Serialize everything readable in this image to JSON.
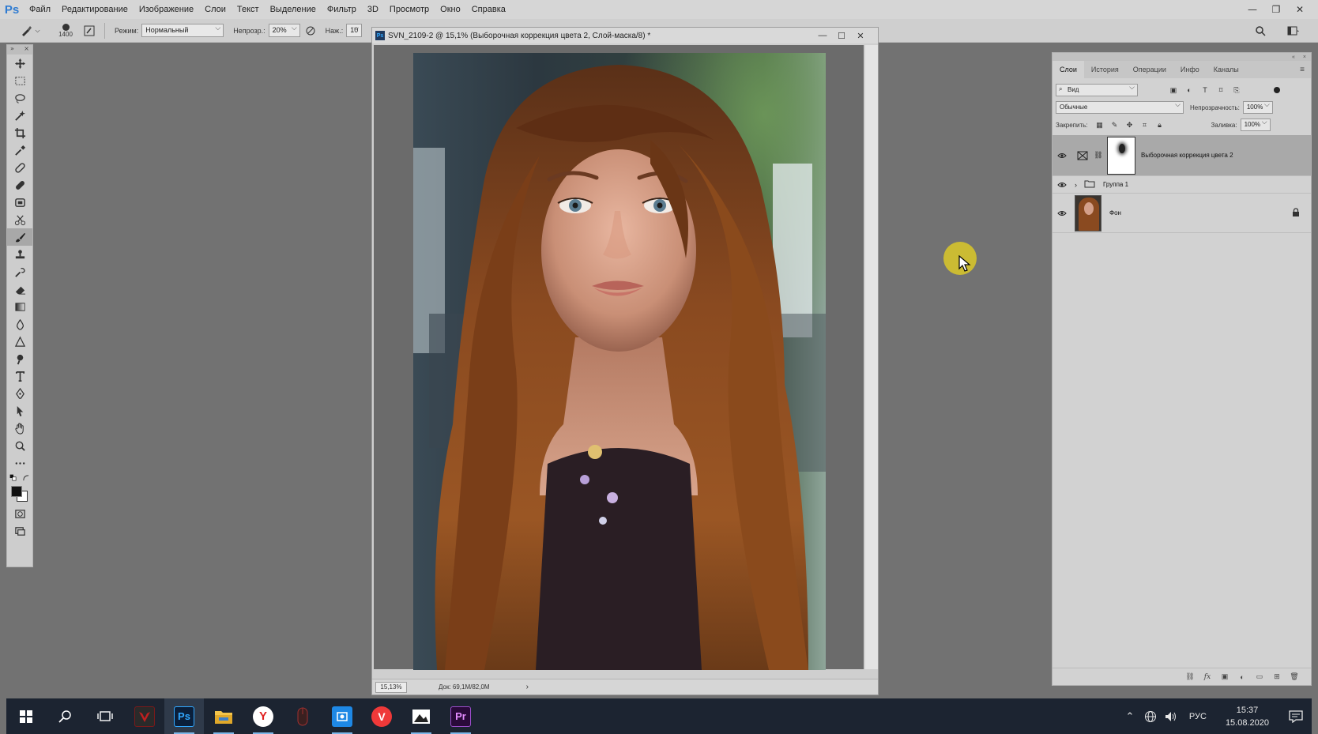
{
  "app": {
    "logo": "Ps",
    "menu": [
      "Файл",
      "Редактирование",
      "Изображение",
      "Слои",
      "Текст",
      "Выделение",
      "Фильтр",
      "3D",
      "Просмотр",
      "Окно",
      "Справка"
    ],
    "window_controls": [
      "—",
      "❐",
      "✕"
    ]
  },
  "options_bar": {
    "brush_size": "1400",
    "mode_label": "Режим:",
    "mode_value": "Нормальный",
    "opacity_label": "Непрозр.:",
    "opacity_value": "20%",
    "pressure_label": "Наж.:",
    "pressure_value": "10"
  },
  "document": {
    "badge": "Ps",
    "title": "SVN_2109-2 @ 15,1% (Выборочная коррекция цвета 2, Слой-маска/8) *",
    "window_controls": [
      "—",
      "☐",
      "✕"
    ],
    "zoom": "15,13%",
    "doc_info": "Док: 69,1M/82,0M",
    "status_arrow": "›"
  },
  "layers_panel": {
    "tabs": [
      "Слои",
      "История",
      "Операции",
      "Инфо",
      "Каналы"
    ],
    "active_tab": "Слои",
    "filter_value": "Вид",
    "blend_mode": "Обычные",
    "opacity_label": "Непрозрачность:",
    "opacity_value": "100%",
    "lock_label": "Закрепить:",
    "fill_label": "Заливка:",
    "fill_value": "100%",
    "layers": [
      {
        "name": "Выборочная коррекция цвета 2",
        "type": "adjustment",
        "visible": true,
        "selected": true
      },
      {
        "name": "Группа 1",
        "type": "group",
        "visible": true,
        "selected": false
      },
      {
        "name": "Фон",
        "type": "image",
        "visible": true,
        "selected": false,
        "locked": true
      }
    ]
  },
  "taskbar": {
    "language": "РУС",
    "time": "15:37",
    "date": "15.08.2020",
    "apps": [
      "start",
      "search",
      "task-view",
      "predator",
      "photoshop",
      "explorer",
      "yandex-browser",
      "mouse-app",
      "screen-capture",
      "vivaldi",
      "photos",
      "premiere"
    ]
  },
  "colors": {
    "accent_ps": "#31a8ff",
    "cursor_highlight": "#dac828",
    "taskbar": "#1c2431"
  }
}
